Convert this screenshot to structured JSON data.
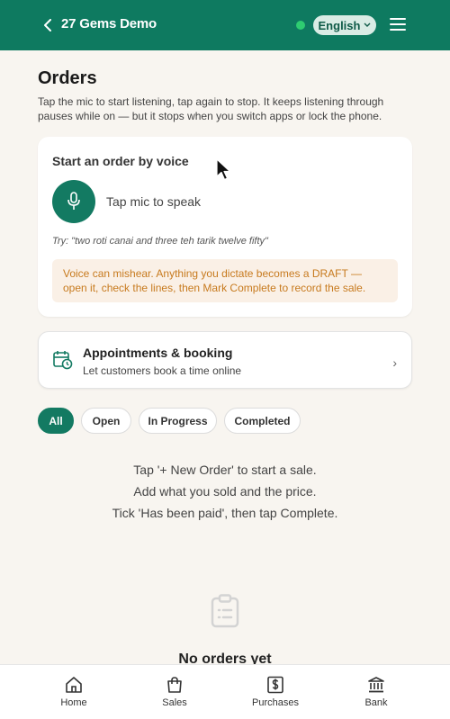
{
  "header": {
    "title": "27 Gems Demo",
    "language": "English",
    "status_color": "#2ecc71",
    "brand_color": "#0e7a60"
  },
  "page": {
    "title": "Orders",
    "description": "Tap the mic to start listening, tap again to stop. It keeps listening through pauses while on — but it stops when you switch apps or lock the phone."
  },
  "voice": {
    "heading": "Start an order by voice",
    "mic_label": "Tap mic to speak",
    "try_text": "Try: \"two roti canai and three teh tarik twelve fifty\"",
    "warning": "Voice can mishear. Anything you dictate becomes a DRAFT — open it, check the lines, then Mark Complete to record the sale."
  },
  "appointments": {
    "title": "Appointments & booking",
    "subtitle": "Let customers book a time online"
  },
  "filters": [
    {
      "label": "All",
      "active": true
    },
    {
      "label": "Open",
      "active": false
    },
    {
      "label": "In Progress",
      "active": false
    },
    {
      "label": "Completed",
      "active": false
    }
  ],
  "empty_state": {
    "lines": [
      "Tap '+ New Order' to start a sale.",
      "Add what you sold and the price.",
      "Tick 'Has been paid', then tap Complete."
    ],
    "title": "No orders yet"
  },
  "bottom_nav": [
    {
      "label": "Home",
      "icon": "home-icon"
    },
    {
      "label": "Sales",
      "icon": "shopping-bag-icon"
    },
    {
      "label": "Purchases",
      "icon": "receipt-dollar-icon"
    },
    {
      "label": "Bank",
      "icon": "bank-icon"
    }
  ]
}
